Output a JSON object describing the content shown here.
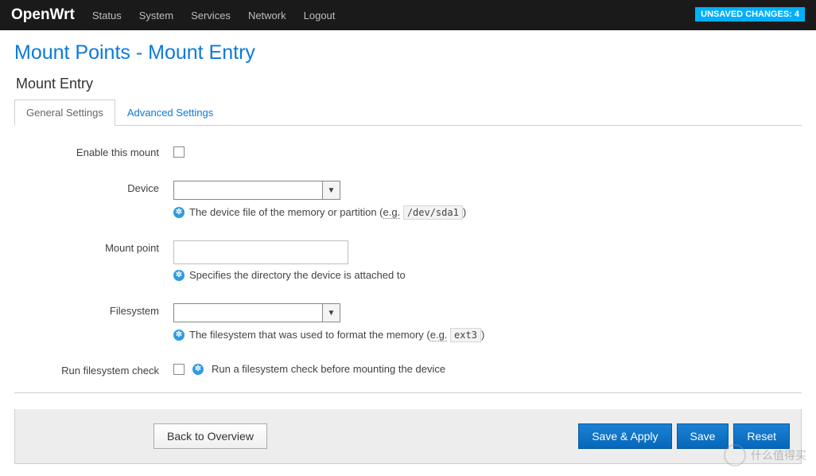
{
  "header": {
    "brand": "OpenWrt",
    "nav": [
      "Status",
      "System",
      "Services",
      "Network",
      "Logout"
    ],
    "badge": "UNSAVED CHANGES: 4"
  },
  "page": {
    "title": "Mount Points - Mount Entry",
    "section_title": "Mount Entry",
    "tabs": [
      {
        "label": "General Settings",
        "active": true
      },
      {
        "label": "Advanced Settings",
        "active": false
      }
    ]
  },
  "form": {
    "enable_label": "Enable this mount",
    "device_label": "Device",
    "device_help_pre": "The device file of the memory or partition (",
    "device_help_eg": "e.g.",
    "device_help_code": "/dev/sda1",
    "device_help_post": ")",
    "mount_label": "Mount point",
    "mount_help": "Specifies the directory the device is attached to",
    "fs_label": "Filesystem",
    "fs_help_pre": "The filesystem that was used to format the memory (",
    "fs_help_eg": "e.g.",
    "fs_help_code": "ext3",
    "fs_help_post": ")",
    "fsck_label": "Run filesystem check",
    "fsck_help": "Run a filesystem check before mounting the device",
    "mount_value": ""
  },
  "buttons": {
    "back": "Back to Overview",
    "save_apply": "Save & Apply",
    "save": "Save",
    "reset": "Reset"
  },
  "watermark": "什么值得买"
}
